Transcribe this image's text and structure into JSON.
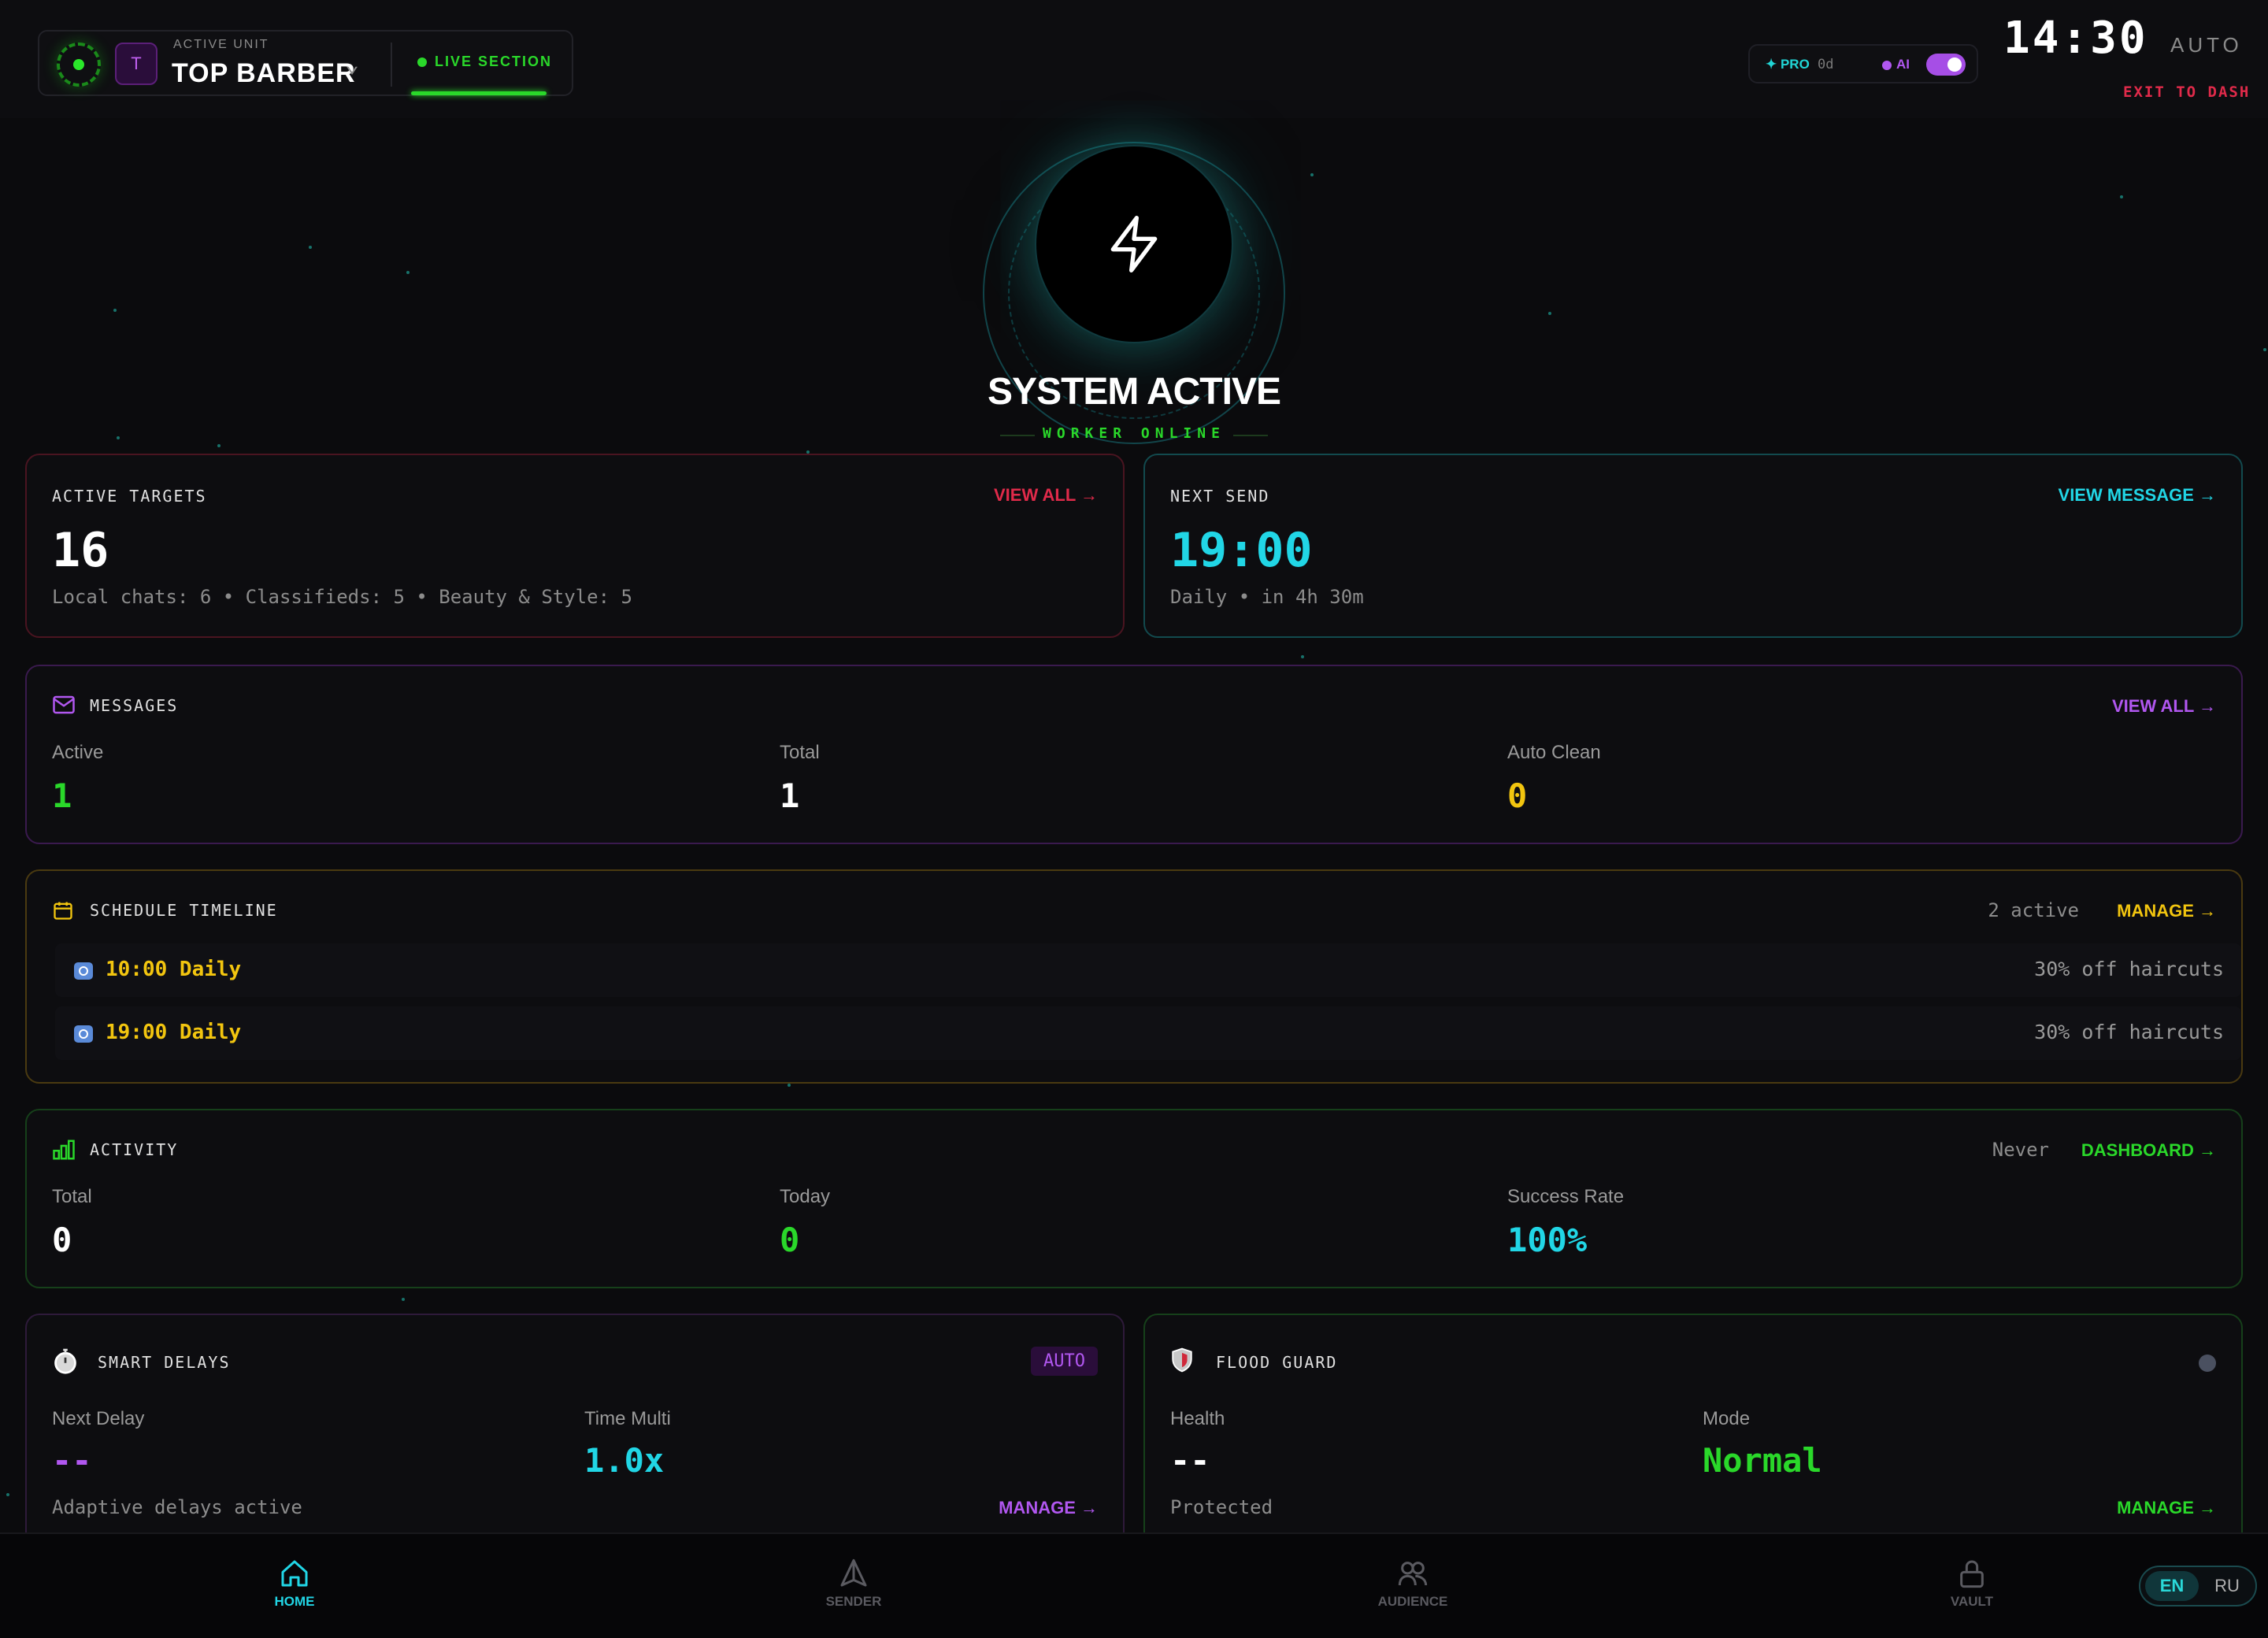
{
  "colors": {
    "green": "#2ad82a",
    "cyan": "#21d6e6",
    "purple": "#b157f0",
    "yellow": "#f2c50f",
    "red": "#e02a4a"
  },
  "header": {
    "unit_label": "ACTIVE UNIT",
    "unit_avatar": "T",
    "unit_name": "TOP BARBER",
    "live_section": "LIVE SECTION",
    "plan": "PRO",
    "plan_days": "0d",
    "ai_label": "AI",
    "ai_enabled": true,
    "clock": "14:30",
    "mode": "AUTO",
    "exit": "EXIT TO DASH"
  },
  "hero": {
    "icon": "lightning-icon",
    "title": "SYSTEM ACTIVE",
    "subtitle": "WORKER ONLINE"
  },
  "active_targets": {
    "label": "ACTIVE TARGETS",
    "link": "VIEW ALL →",
    "count": "16",
    "breakdown": "Local chats: 6 • Classifieds: 5 • Beauty & Style: 5"
  },
  "next_send": {
    "label": "NEXT SEND",
    "link": "VIEW MESSAGE →",
    "time": "19:00",
    "detail": "Daily • in 4h 30m"
  },
  "messages": {
    "label": "MESSAGES",
    "link": "VIEW ALL →",
    "stats": [
      {
        "label": "Active",
        "value": "1"
      },
      {
        "label": "Total",
        "value": "1"
      },
      {
        "label": "Auto Clean",
        "value": "0"
      }
    ]
  },
  "schedule": {
    "label": "SCHEDULE TIMELINE",
    "active_count": "2 active",
    "link": "MANAGE →",
    "items": [
      {
        "time": "10:00 Daily",
        "message": "30% off haircuts"
      },
      {
        "time": "19:00 Daily",
        "message": "30% off haircuts"
      }
    ]
  },
  "activity": {
    "label": "ACTIVITY",
    "last": "Never",
    "link": "DASHBOARD →",
    "stats": [
      {
        "label": "Total",
        "value": "0"
      },
      {
        "label": "Today",
        "value": "0"
      },
      {
        "label": "Success Rate",
        "value": "100%"
      }
    ]
  },
  "smart_delays": {
    "label": "SMART DELAYS",
    "badge": "AUTO",
    "next_delay_label": "Next Delay",
    "next_delay_value": "--",
    "multi_label": "Time Multi",
    "multi_value": "1.0x",
    "note": "Adaptive delays active",
    "link": "MANAGE →"
  },
  "flood_guard": {
    "label": "FLOOD GUARD",
    "health_label": "Health",
    "health_value": "--",
    "mode_label": "Mode",
    "mode_value": "Normal",
    "note": "Protected",
    "link": "MANAGE →"
  },
  "nav": {
    "items": [
      {
        "label": "HOME",
        "icon": "home-icon",
        "active": true
      },
      {
        "label": "SENDER",
        "icon": "sender-icon",
        "active": false
      },
      {
        "label": "AUDIENCE",
        "icon": "audience-icon",
        "active": false
      },
      {
        "label": "VAULT",
        "icon": "lock-icon",
        "active": false
      }
    ],
    "lang_en": "EN",
    "lang_ru": "RU"
  }
}
